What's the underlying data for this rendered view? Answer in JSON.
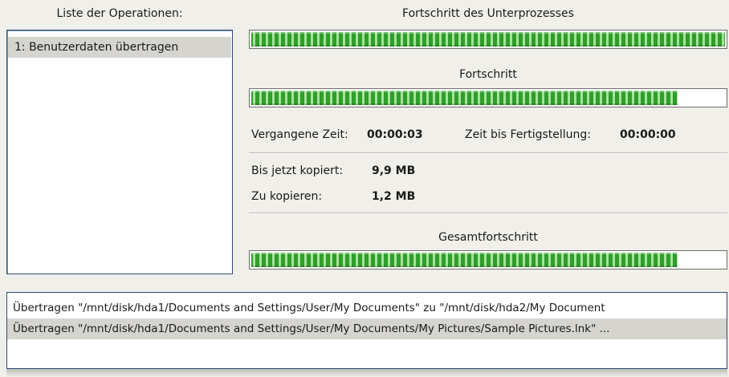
{
  "operations": {
    "title": "Liste der Operationen:",
    "items": [
      "1: Benutzerdaten übertragen"
    ]
  },
  "subprocess": {
    "title": "Fortschritt des Unterprozesses",
    "progress": 1.0
  },
  "progress": {
    "title": "Fortschritt",
    "progress": 0.9
  },
  "time": {
    "elapsed_label": "Vergangene Zeit:",
    "elapsed_value": "00:00:03",
    "remaining_label": "Zeit bis Fertigstellung:",
    "remaining_value": "00:00:00"
  },
  "copy": {
    "copied_label": "Bis jetzt kopiert:",
    "copied_value": "9,9 MB",
    "to_copy_label": "Zu kopieren:",
    "to_copy_value": "1,2 MB"
  },
  "total": {
    "title": "Gesamtfortschritt",
    "progress": 0.9
  },
  "log": {
    "lines": [
      "Übertragen \"/mnt/disk/hda1/Documents and Settings/User/My Documents\" zu \"/mnt/disk/hda2/My Document",
      "Übertragen \"/mnt/disk/hda1/Documents and Settings/User/My Documents/My Pictures/Sample Pictures.lnk\" ..."
    ],
    "selected_index": 1
  },
  "colors": {
    "progress_fill": "#2f9e2a",
    "panel_border": "#2b4a7a",
    "selection": "#d5d4cf",
    "background": "#f0efe9"
  }
}
